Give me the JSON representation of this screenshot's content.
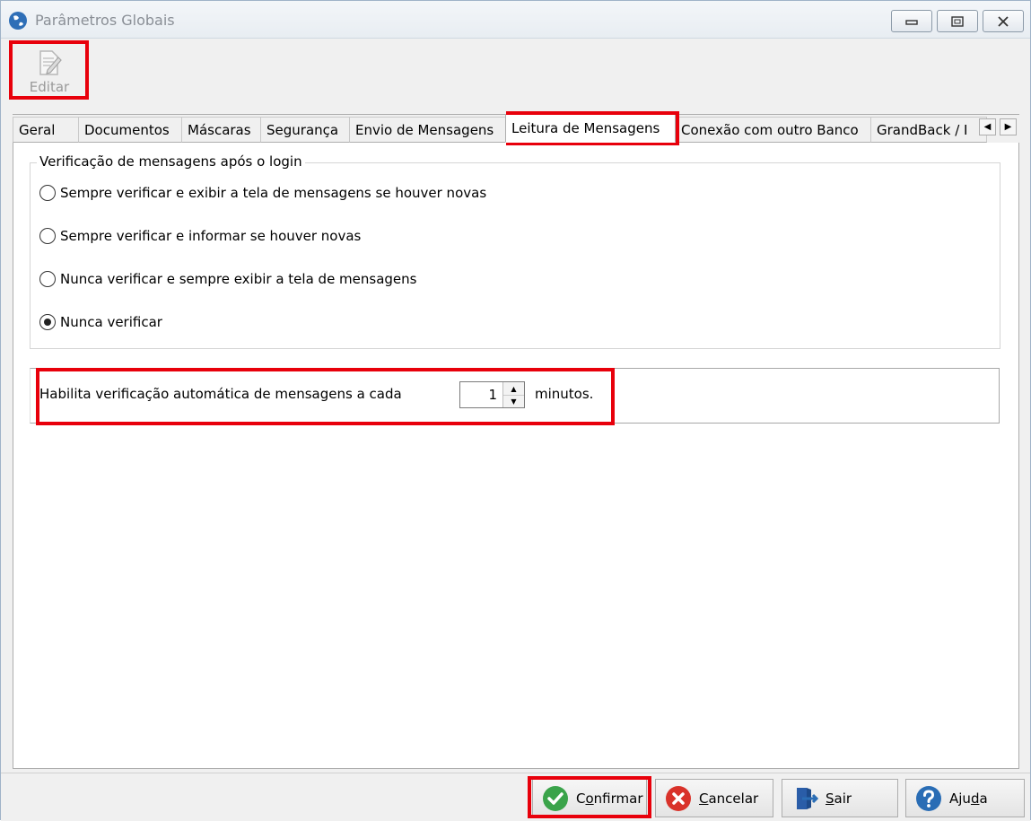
{
  "window": {
    "title": "Parâmetros Globais"
  },
  "toolbar": {
    "edit_label": "Editar"
  },
  "tabs": [
    {
      "label": "Geral"
    },
    {
      "label": "Documentos"
    },
    {
      "label": "Máscaras"
    },
    {
      "label": "Segurança"
    },
    {
      "label": "Envio de Mensagens"
    },
    {
      "label": "Leitura de Mensagens",
      "active": true
    },
    {
      "label": "Conexão com outro Banco"
    },
    {
      "label": "GrandBack / I"
    }
  ],
  "login_check": {
    "legend": "Verificação de mensagens após o login",
    "options": [
      {
        "label": "Sempre verificar e exibir a tela de mensagens se houver novas",
        "checked": false
      },
      {
        "label": "Sempre verificar e informar se houver novas",
        "checked": false
      },
      {
        "label": "Nunca verificar e sempre exibir a tela de mensagens",
        "checked": false
      },
      {
        "label": "Nunca verificar",
        "checked": true
      }
    ]
  },
  "auto_check": {
    "label": "Habilita verificação automática de mensagens a cada",
    "value": "1",
    "suffix": "minutos."
  },
  "footer": {
    "confirm_pre": "C",
    "confirm_u": "o",
    "confirm_post": "nfirmar",
    "cancel_pre": "",
    "cancel_u": "C",
    "cancel_post": "ancelar",
    "exit_pre": "",
    "exit_u": "S",
    "exit_post": "air",
    "help_pre": "Aju",
    "help_u": "d",
    "help_post": "a"
  },
  "colors": {
    "highlight": "#e8000b",
    "confirm_icon": "#3aa34a",
    "cancel_icon": "#d9322a",
    "help_icon": "#2a6db5"
  }
}
